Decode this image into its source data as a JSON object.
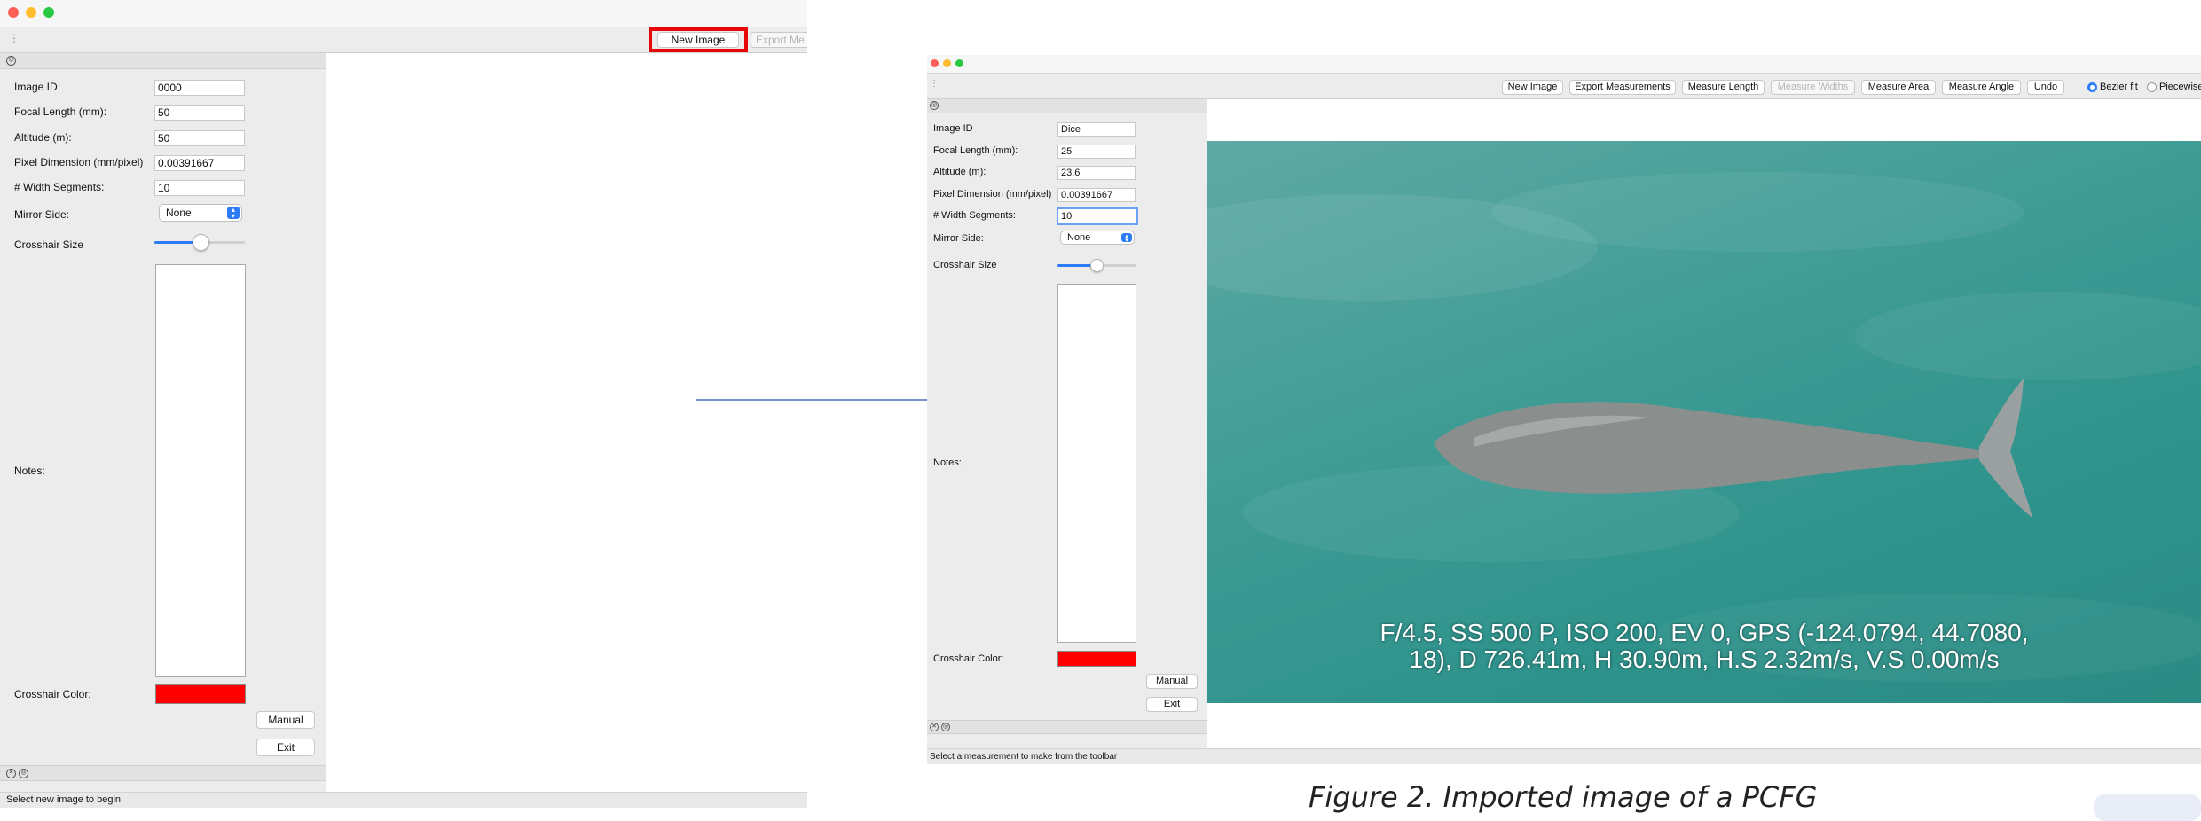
{
  "left_window": {
    "toolbar": {
      "new_image": "New Image",
      "export_measurements": "Export Me"
    },
    "fields": [
      {
        "label": "Image ID",
        "value": "0000"
      },
      {
        "label": "Focal Length (mm):",
        "value": "50"
      },
      {
        "label": "Altitude (m):",
        "value": "50"
      },
      {
        "label": "Pixel Dimension (mm/pixel)",
        "value": "0.00391667"
      },
      {
        "label": "# Width Segments:",
        "value": "10"
      }
    ],
    "mirror_side": {
      "label": "Mirror Side:",
      "value": "None"
    },
    "crosshair_size": {
      "label": "Crosshair Size",
      "value_fraction": 0.5
    },
    "notes_label": "Notes:",
    "crosshair_color": {
      "label": "Crosshair Color:",
      "color": "#ff0000"
    },
    "manual_button": "Manual",
    "exit_button": "Exit",
    "status": "Select new image to begin",
    "highlight_color": "#e8060b"
  },
  "arrow_color": "#4a72b8",
  "right_window": {
    "toolbar": {
      "new_image": "New Image",
      "export_measurements": "Export Measurements",
      "measure_length": "Measure Length",
      "measure_widths": "Measure Widths",
      "measure_area": "Measure Area",
      "measure_angle": "Measure Angle",
      "undo": "Undo",
      "bezier_fit": "Bezier fit",
      "piecewise": "Piecewise"
    },
    "fields": [
      {
        "label": "Image ID",
        "value": "Dice"
      },
      {
        "label": "Focal Length (mm):",
        "value": "25"
      },
      {
        "label": "Altitude (m):",
        "value": "23.6"
      },
      {
        "label": "Pixel Dimension (mm/pixel)",
        "value": "0.00391667"
      },
      {
        "label": "# Width Segments:",
        "value": "10"
      }
    ],
    "mirror_side": {
      "label": "Mirror Side:",
      "value": "None"
    },
    "crosshair_size": {
      "label": "Crosshair Size",
      "value_fraction": 0.5
    },
    "notes_label": "Notes:",
    "crosshair_color": {
      "label": "Crosshair Color:",
      "color": "#ff0000"
    },
    "manual_button": "Manual",
    "exit_button": "Exit",
    "status": "Select a measurement to make from the toolbar",
    "image_overlay": {
      "line1": "F/4.5, SS 500 P, ISO 200, EV 0, GPS (-124.0794, 44.7080,",
      "line2": "18), D 726.41m, H 30.90m, H.S 2.32m/s, V.S 0.00m/s"
    }
  },
  "caption": "Figure 2. Imported image of a PCFG"
}
